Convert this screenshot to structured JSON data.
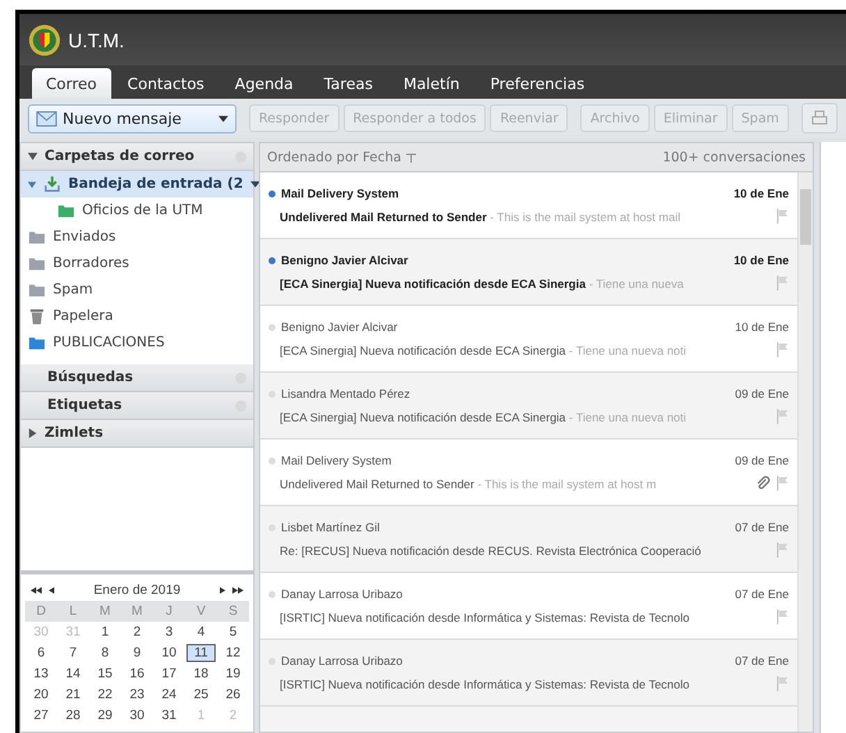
{
  "app": {
    "title": "U.T.M."
  },
  "tabs": [
    {
      "label": "Correo",
      "selected": true
    },
    {
      "label": "Contactos",
      "selected": false
    },
    {
      "label": "Agenda",
      "selected": false
    },
    {
      "label": "Tareas",
      "selected": false
    },
    {
      "label": "Maletín",
      "selected": false
    },
    {
      "label": "Preferencias",
      "selected": false
    }
  ],
  "new_message": {
    "label": "Nuevo mensaje"
  },
  "toolbar": [
    {
      "label": "Responder",
      "disabled": true
    },
    {
      "label": "Responder a todos",
      "disabled": true
    },
    {
      "label": "Reenviar",
      "disabled": true
    },
    {
      "label": "Archivo",
      "disabled": true
    },
    {
      "label": "Eliminar",
      "disabled": true
    },
    {
      "label": "Spam",
      "disabled": true
    }
  ],
  "sidebar": {
    "folders_header": {
      "label": "Carpetas de correo",
      "expanded": true
    },
    "folders": [
      {
        "label": "Bandeja de entrada (2",
        "kind": "inbox",
        "selected": true,
        "expanded": true,
        "children": [
          {
            "label": "Oficios de la UTM",
            "kind": "folder-green",
            "selected": false
          }
        ]
      },
      {
        "label": "Enviados",
        "kind": "sent",
        "selected": false
      },
      {
        "label": "Borradores",
        "kind": "drafts",
        "selected": false
      },
      {
        "label": "Spam",
        "kind": "spam",
        "selected": false
      },
      {
        "label": "Papelera",
        "kind": "trash",
        "selected": false
      },
      {
        "label": "PUBLICACIONES",
        "kind": "folder-blue",
        "selected": false
      }
    ],
    "sections": [
      {
        "label": "Búsquedas",
        "expandable": false
      },
      {
        "label": "Etiquetas",
        "expandable": false
      },
      {
        "label": "Zimlets",
        "expandable": true
      }
    ]
  },
  "calendar": {
    "month": "Enero de 2019",
    "weekdays": [
      "D",
      "L",
      "M",
      "M",
      "J",
      "V",
      "S"
    ],
    "weeks": [
      [
        {
          "day": "30",
          "other": true,
          "selected": false
        },
        {
          "day": "31",
          "other": true,
          "selected": false
        },
        {
          "day": "1",
          "other": false,
          "selected": false
        },
        {
          "day": "2",
          "other": false,
          "selected": false
        },
        {
          "day": "3",
          "other": false,
          "selected": false
        },
        {
          "day": "4",
          "other": false,
          "selected": false
        },
        {
          "day": "5",
          "other": false,
          "selected": false
        }
      ],
      [
        {
          "day": "6",
          "other": false,
          "selected": false
        },
        {
          "day": "7",
          "other": false,
          "selected": false
        },
        {
          "day": "8",
          "other": false,
          "selected": false
        },
        {
          "day": "9",
          "other": false,
          "selected": false
        },
        {
          "day": "10",
          "other": false,
          "selected": false
        },
        {
          "day": "11",
          "other": false,
          "selected": true
        },
        {
          "day": "12",
          "other": false,
          "selected": false
        }
      ],
      [
        {
          "day": "13",
          "other": false,
          "selected": false
        },
        {
          "day": "14",
          "other": false,
          "selected": false
        },
        {
          "day": "15",
          "other": false,
          "selected": false
        },
        {
          "day": "16",
          "other": false,
          "selected": false
        },
        {
          "day": "17",
          "other": false,
          "selected": false
        },
        {
          "day": "18",
          "other": false,
          "selected": false
        },
        {
          "day": "19",
          "other": false,
          "selected": false
        }
      ],
      [
        {
          "day": "20",
          "other": false,
          "selected": false
        },
        {
          "day": "21",
          "other": false,
          "selected": false
        },
        {
          "day": "22",
          "other": false,
          "selected": false
        },
        {
          "day": "23",
          "other": false,
          "selected": false
        },
        {
          "day": "24",
          "other": false,
          "selected": false
        },
        {
          "day": "25",
          "other": false,
          "selected": false
        },
        {
          "day": "26",
          "other": false,
          "selected": false
        }
      ],
      [
        {
          "day": "27",
          "other": false,
          "selected": false
        },
        {
          "day": "28",
          "other": false,
          "selected": false
        },
        {
          "day": "29",
          "other": false,
          "selected": false
        },
        {
          "day": "30",
          "other": false,
          "selected": false
        },
        {
          "day": "31",
          "other": false,
          "selected": false
        },
        {
          "day": "1",
          "other": true,
          "selected": false
        },
        {
          "day": "2",
          "other": true,
          "selected": false
        }
      ]
    ]
  },
  "list": {
    "sort": "Ordenado por Fecha",
    "count": "100+ conversaciones",
    "messages": [
      {
        "sender": "Mail Delivery System",
        "date": "10 de Ene",
        "subject": "Undelivered Mail Returned to Sender",
        "snippet": " - This is the mail system at host mail",
        "unread": true,
        "attachment": false
      },
      {
        "sender": "Benigno Javier Alcivar",
        "date": "10 de Ene",
        "subject": "[ECA Sinergia] Nueva notificación desde ECA Sinergia",
        "snippet": " - Tiene una nueva",
        "unread": true,
        "attachment": false
      },
      {
        "sender": "Benigno Javier Alcivar",
        "date": "10 de Ene",
        "subject": "[ECA Sinergia] Nueva notificación desde ECA Sinergia",
        "snippet": " - Tiene una nueva noti",
        "unread": false,
        "attachment": false
      },
      {
        "sender": "Lisandra Mentado Pérez",
        "date": "09 de Ene",
        "subject": "[ECA Sinergia] Nueva notificación desde ECA Sinergia",
        "snippet": " - Tiene una nueva noti",
        "unread": false,
        "attachment": false
      },
      {
        "sender": "Mail Delivery System",
        "date": "09 de Ene",
        "subject": "Undelivered Mail Returned to Sender",
        "snippet": " - This is the mail system at host m",
        "unread": false,
        "attachment": true
      },
      {
        "sender": "Lisbet Martínez Gil",
        "date": "07 de Ene",
        "subject": "Re: [RECUS] Nueva notificación desde RECUS. Revista Electrónica Cooperació",
        "unread": false,
        "attachment": false
      },
      {
        "sender": "Danay Larrosa Uribazo",
        "date": "07 de Ene",
        "subject": "[ISRTIC] Nueva notificación desde Informática y Sistemas: Revista de Tecnolo",
        "unread": false,
        "attachment": false
      },
      {
        "sender": "Danay Larrosa Uribazo",
        "date": "07 de Ene",
        "subject": "[ISRTIC] Nueva notificación desde Informática y Sistemas: Revista de Tecnolo",
        "unread": false,
        "attachment": false
      }
    ]
  }
}
